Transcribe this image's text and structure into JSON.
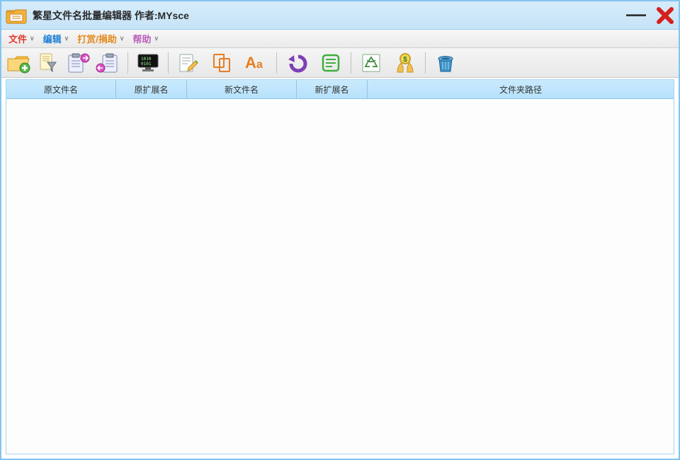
{
  "title": "繁星文件名批量编辑器  作者:MYsce",
  "menu": {
    "file": "文件",
    "edit": "编辑",
    "donate": "打赏/捐助",
    "help": "帮助"
  },
  "toolbar": {
    "add_files": "add-files",
    "filter": "filter",
    "clipboard_export": "clipboard-export",
    "clipboard_import": "clipboard-import",
    "binary": "binary",
    "rename": "rename",
    "copy": "copy",
    "case": "case-change",
    "undo": "undo",
    "apply": "apply",
    "recycle": "recycle",
    "donate": "donate",
    "trash": "trash"
  },
  "columns": {
    "orig_name": "原文件名",
    "orig_ext": "原扩展名",
    "new_name": "新文件名",
    "new_ext": "新扩展名",
    "folder_path": "文件夹路径"
  },
  "rows": []
}
